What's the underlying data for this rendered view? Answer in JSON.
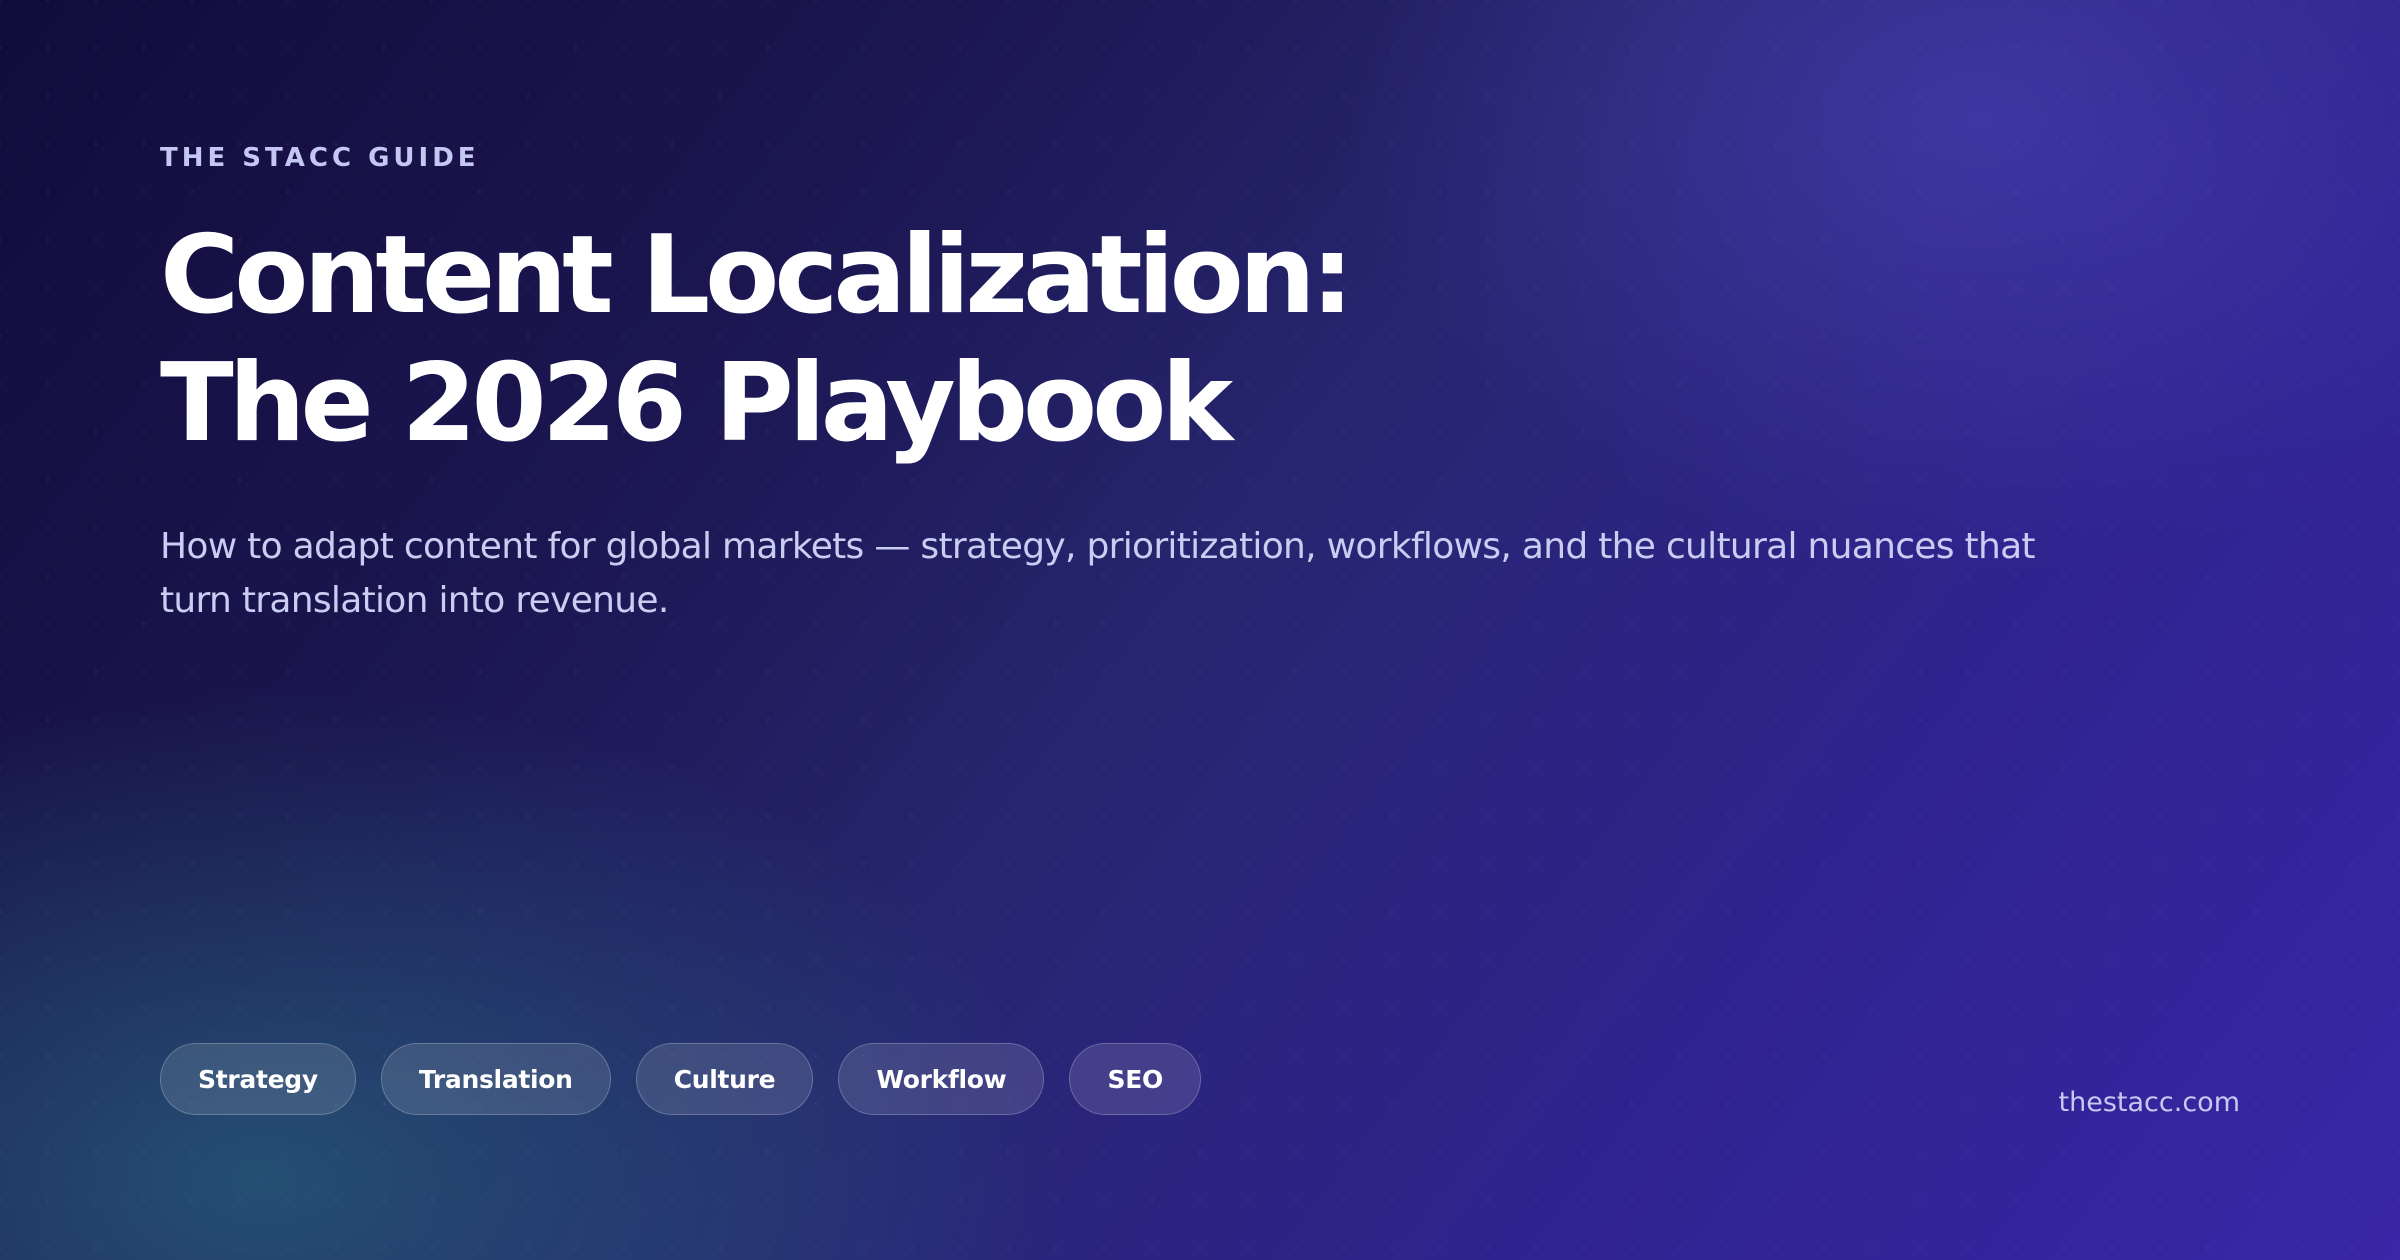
{
  "hero": {
    "eyebrow": "THE STACC GUIDE",
    "title_line1": "Content Localization:",
    "title_line2": "The 2026 Playbook",
    "subtitle": "How to adapt content for global markets — strategy, prioritization, workflows, and the cultural nuances that turn translation into revenue.",
    "tags": [
      "Strategy",
      "Translation",
      "Culture",
      "Workflow",
      "SEO"
    ],
    "domain": "thestacc.com"
  },
  "colors": {
    "background_dark": "#120c3c",
    "background_purple": "#3a26a6",
    "background_teal": "#26587a",
    "eyebrow_text": "#c4c7f2",
    "subtitle_text": "#c9cdf2",
    "title_text": "#ffffff"
  }
}
